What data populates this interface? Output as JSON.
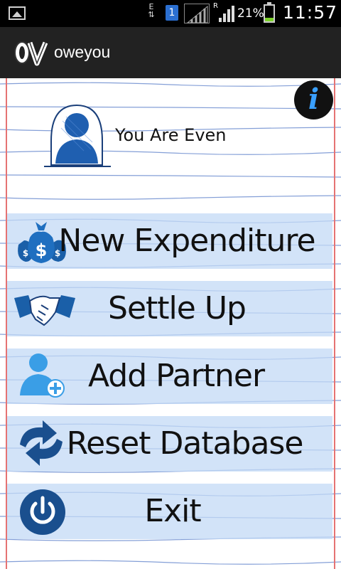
{
  "status_bar": {
    "data_indicator": "E",
    "sim_slot": "1",
    "roaming": "R",
    "battery_percent": "21%",
    "battery_level": 0.21,
    "time": "11:57"
  },
  "action_bar": {
    "title": "oweyou",
    "logo_text": "oV"
  },
  "header": {
    "info_icon": "i",
    "status_text": "You Are Even"
  },
  "menu": [
    {
      "label": "New Expenditure",
      "icon": "money-bags-icon"
    },
    {
      "label": "Settle Up",
      "icon": "handshake-icon"
    },
    {
      "label": "Add Partner",
      "icon": "add-person-icon"
    },
    {
      "label": "Reset Database",
      "icon": "refresh-arrows-icon"
    },
    {
      "label": "Exit",
      "icon": "power-icon"
    }
  ],
  "colors": {
    "menu_band": "#c3d9f5",
    "ruled_line": "#5b7fc9",
    "margin_line": "#e57373",
    "icon_blue": "#1a5fa8"
  }
}
